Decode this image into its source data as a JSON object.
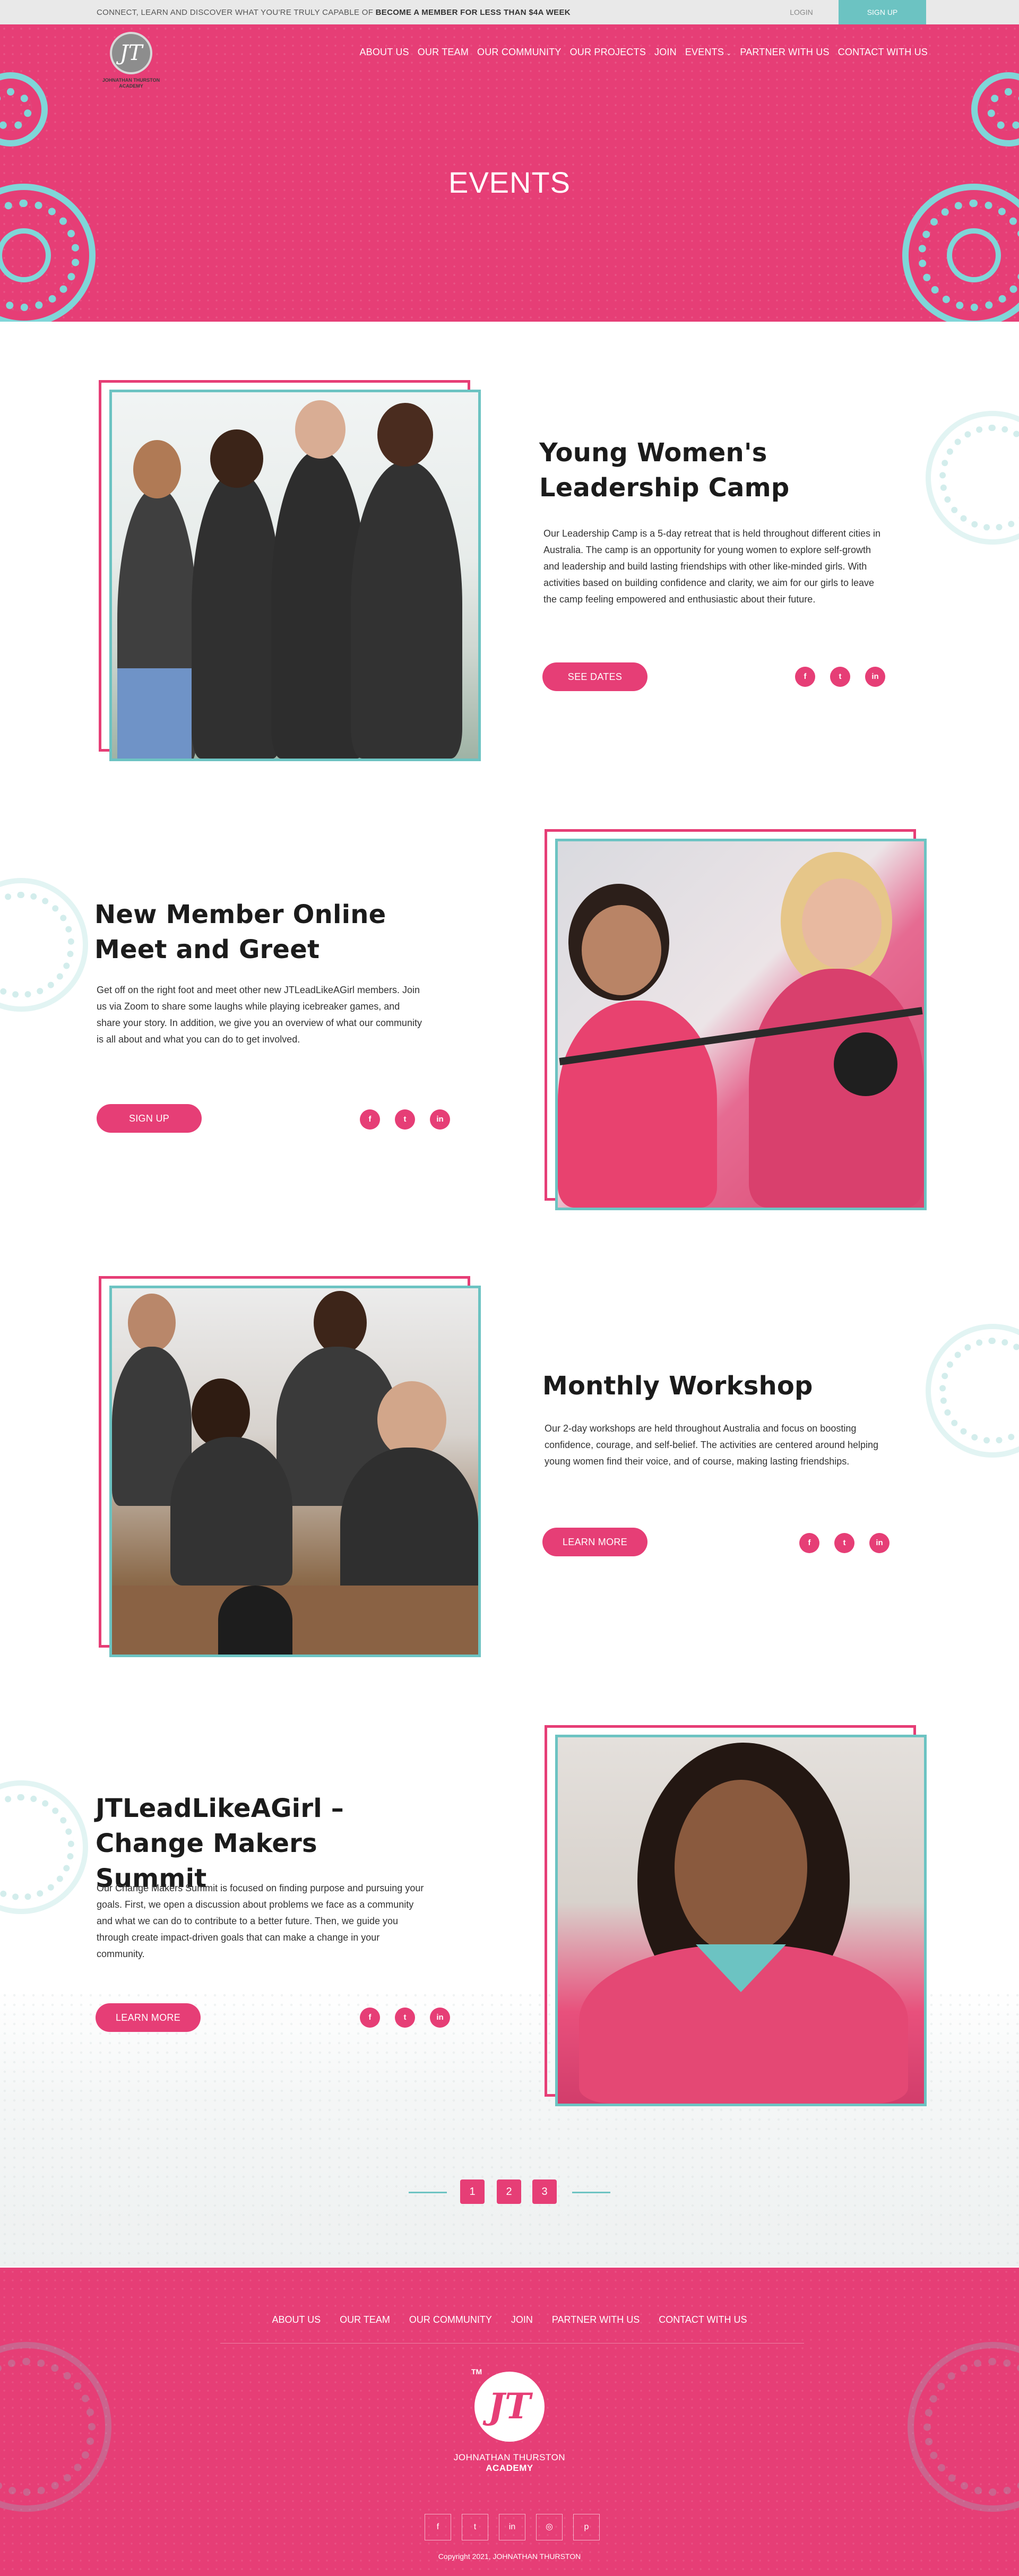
{
  "topbar": {
    "promo_lead": "CONNECT, LEARN AND DISCOVER WHAT YOU'RE TRULY CAPABLE OF",
    "promo_bold": "BECOME A MEMBER FOR LESS THAN $4A WEEK",
    "login": "LOGIN",
    "signup": "SIGN UP"
  },
  "logo": {
    "mark": "JT",
    "line1": "JOHNATHAN THURSTON",
    "line2": "ACADEMY"
  },
  "nav": {
    "items": [
      "ABOUT US",
      "OUR TEAM",
      "OUR COMMUNITY",
      "OUR PROJECTS",
      "JOIN",
      "EVENTS",
      "PARTNER WITH US",
      "CONTACT WITH US"
    ],
    "events_has_dropdown": true
  },
  "hero": {
    "title": "EVENTS"
  },
  "events": [
    {
      "title": "Young Women's Leadership Camp",
      "text": "Our Leadership Camp is a 5-day retreat that is held throughout different cities in Australia. The camp is an opportunity for young women to explore self-growth and leadership and build lasting friendships with other like-minded girls. With activities based on building confidence and clarity, we aim for our girls to leave the camp feeling empowered and enthusiastic about their future.",
      "button": "SEE DATES"
    },
    {
      "title": "New Member Online Meet and Greet",
      "text": "Get off on the right foot and meet other new JTLeadLikeAGirl members. Join us via Zoom to share some laughs while playing icebreaker games, and share your story. In addition, we give you an overview of what our community is all about and what you can do to get involved.",
      "button": "SIGN UP"
    },
    {
      "title": "Monthly Workshop",
      "text": "Our 2-day workshops are held throughout Australia and focus on boosting confidence, courage, and self-belief. The activities are centered around helping young women find their voice, and of course, making lasting friendships.",
      "button": "LEARN MORE"
    },
    {
      "title": "JTLeadLikeAGirl – Change Makers Summit",
      "text": "Our Change Makers Summit is focused on finding purpose and pursuing your goals. First, we open a discussion about problems we face as a community and what we can do to contribute to a better future. Then, we guide you through create impact-driven goals that can make a change in your community.",
      "button": "LEARN MORE"
    }
  ],
  "social_icons": [
    "facebook-icon",
    "twitter-icon",
    "linkedin-icon"
  ],
  "social_glyphs": {
    "facebook": "f",
    "twitter": "t",
    "linkedin": "in",
    "instagram": "◎",
    "pinterest": "p"
  },
  "pagination": {
    "pages": [
      "1",
      "2",
      "3"
    ]
  },
  "footer": {
    "nav": [
      "ABOUT US",
      "OUR TEAM",
      "OUR COMMUNITY",
      "JOIN",
      "PARTNER WITH US",
      "CONTACT WITH US"
    ],
    "tm": "TM",
    "mark": "JT",
    "name_line1": "JOHNATHAN THURSTON",
    "name_line2": "ACADEMY",
    "copyright": "Copyright 2021, JOHNATHAN THURSTON"
  },
  "colors": {
    "brand_pink": "#e63e76",
    "accent_teal": "#6cc3c2",
    "topbar_bg": "#e9e9e9"
  }
}
